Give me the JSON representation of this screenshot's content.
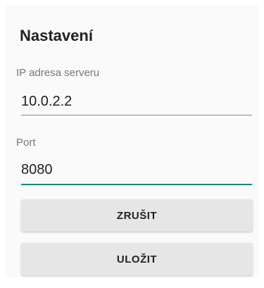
{
  "dialog": {
    "title": "Nastavení",
    "fields": [
      {
        "label": "IP adresa serveru",
        "value": "10.0.2.2",
        "focused": false
      },
      {
        "label": "Port",
        "value": "8080",
        "focused": true
      }
    ],
    "buttons": {
      "cancel_label": "ZRUŠIT",
      "save_label": "ULOŽIT"
    }
  },
  "colors": {
    "accent": "#00897b",
    "dialog_background": "#fafafa",
    "button_background": "#e6e6e6",
    "label_text": "#757575",
    "primary_text": "#212121"
  }
}
